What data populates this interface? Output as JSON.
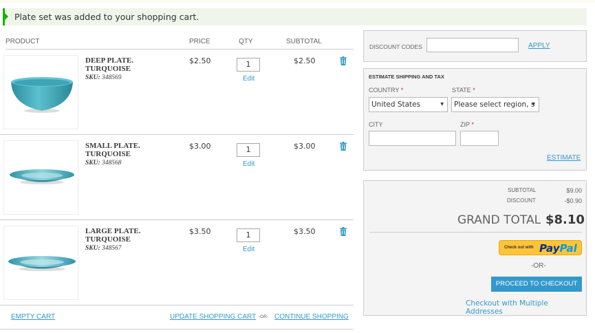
{
  "message": "Plate set was added to your shopping cart.",
  "columns": {
    "product": "PRODUCT",
    "price": "PRICE",
    "qty": "QTY",
    "subtotal": "SUBTOTAL"
  },
  "items": [
    {
      "name": "DEEP PLATE. TURQUOISE",
      "sku_label": "SKU:",
      "sku": "348569",
      "price": "$2.50",
      "qty": "1",
      "edit": "Edit",
      "subtotal": "$2.50"
    },
    {
      "name": "SMALL PLATE. TURQUOISE",
      "sku_label": "SKU:",
      "sku": "348568",
      "price": "$3.00",
      "qty": "1",
      "edit": "Edit",
      "subtotal": "$3.00"
    },
    {
      "name": "LARGE PLATE. TURQUOISE",
      "sku_label": "SKU:",
      "sku": "348567",
      "price": "$3.50",
      "qty": "1",
      "edit": "Edit",
      "subtotal": "$3.50"
    }
  ],
  "footer": {
    "empty": "EMPTY CART",
    "update": "UPDATE SHOPPING CART",
    "or": "-OR-",
    "continue": "CONTINUE SHOPPING"
  },
  "discount": {
    "label": "DISCOUNT CODES",
    "apply": "APPLY",
    "value": ""
  },
  "shipping": {
    "title": "ESTIMATE SHIPPING AND TAX",
    "country_label": "COUNTRY",
    "country_value": "United States",
    "state_label": "STATE",
    "state_value": "Please select region, s",
    "city_label": "CITY",
    "zip_label": "ZIP",
    "required": "*",
    "estimate": "ESTIMATE"
  },
  "totals": {
    "subtotal_label": "SUBTOTAL",
    "subtotal": "$9.00",
    "discount_label": "DISCOUNT",
    "discount": "-$0.90",
    "grand_label": "GRAND TOTAL",
    "grand": "$8.10",
    "paypal_small": "Check out with",
    "paypal_pay": "Pay",
    "paypal_pal": "Pal",
    "or": "-OR-",
    "checkout": "PROCEED TO CHECKOUT",
    "multi": "Checkout with Multiple Addresses"
  },
  "colors": {
    "accent": "#3399cc",
    "success": "#11b400",
    "paypal": "#ffc439",
    "plate": "#3aa3b5"
  }
}
